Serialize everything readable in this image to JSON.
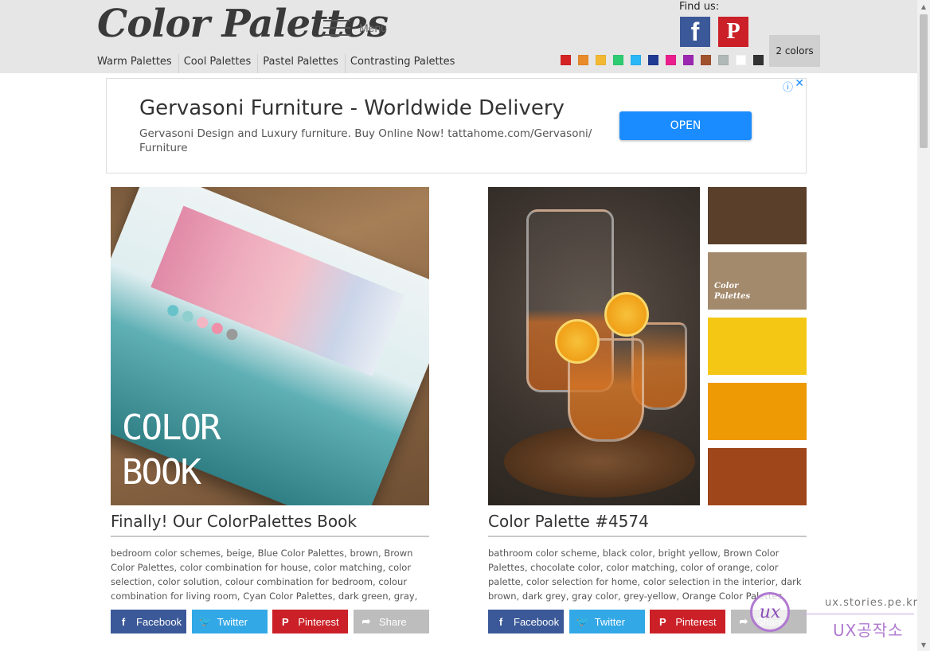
{
  "header": {
    "logo": "Color Palettes",
    "menu_label": "Menu",
    "nav": [
      "Warm Palettes",
      "Cool Palettes",
      "Pastel Palettes",
      "Contrasting Palettes"
    ],
    "find_us": "Find us:",
    "facebook_glyph": "f",
    "pinterest_glyph": "P",
    "color_filter": [
      "#d42323",
      "#e98b2a",
      "#f3b933",
      "#2ecc71",
      "#29b6f6",
      "#1f3a93",
      "#e91e8c",
      "#9b27b0",
      "#a0522d",
      "#b0b7b7",
      "#ffffff",
      "#333333"
    ],
    "two_colors_label": "2 colors"
  },
  "ad": {
    "title": "Gervasoni Furniture - Worldwide Delivery",
    "description": "Gervasoni Design and Luxury furniture. Buy Online Now! tattahome.com/Gervasoni/ Furniture",
    "cta": "OPEN",
    "info_icon": "ⓘ",
    "close_icon": "✕"
  },
  "cards": [
    {
      "image_text_line1": "COLOR",
      "image_text_line2": "BOOK",
      "title": "Finally! Our ColorPalettes Book",
      "tags": "bedroom color schemes, beige, Blue Color Palettes, brown, Brown Color Palettes, color combination for house, color matching, color selection, color solution, colour combination for bedroom, colour combination for living room, Cyan Color Palettes, dark green, gray,"
    },
    {
      "title": "Color Palette #4574",
      "palette": [
        "#5a3f2b",
        "#a48a6c",
        "#f4c715",
        "#ee9a05",
        "#a0461b"
      ],
      "palette_logo_line1": "Color",
      "palette_logo_line2": "Palettes",
      "tags": "bathroom color scheme, black color, bright yellow, Brown Color Palettes, chocolate color, color matching, color of orange, color palette, color selection for home, color selection in the interior, dark brown, dark grey, gray color, grey-yellow, Orange Color Palettes, saffron color,"
    }
  ],
  "share": {
    "facebook": "Facebook",
    "twitter": "Twitter",
    "pinterest": "Pinterest",
    "share": "Share",
    "facebook_icon": "f",
    "twitter_icon": "🐦",
    "pinterest_icon": "P",
    "share_icon": "➦"
  },
  "watermark": {
    "logo_text": "ux",
    "url": "ux.stories.pe.kr",
    "name": "UX공작소"
  }
}
